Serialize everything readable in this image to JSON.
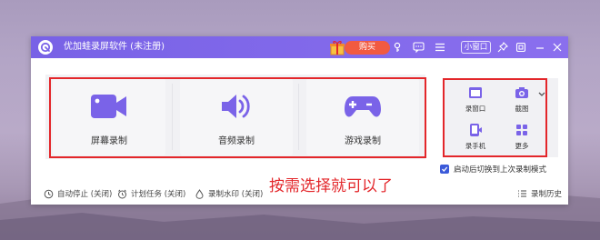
{
  "window": {
    "title": "优加蛙录屏软件 (未注册)",
    "buy_label": "购买",
    "mini_label": "小窗口"
  },
  "modes": [
    {
      "label": "屏幕录制",
      "icon": "video-camera-icon"
    },
    {
      "label": "音频录制",
      "icon": "speaker-icon"
    },
    {
      "label": "游戏录制",
      "icon": "gamepad-icon"
    }
  ],
  "side_tools": [
    {
      "label": "录窗口",
      "icon": "window-icon"
    },
    {
      "label": "截图",
      "icon": "camera-icon"
    },
    {
      "label": "录手机",
      "icon": "phone-icon"
    },
    {
      "label": "更多",
      "icon": "grid-icon"
    }
  ],
  "checkbox": {
    "label": "启动后切换到上次录制模式",
    "checked": true
  },
  "annotation": "按需选择就可以了",
  "footer": {
    "auto_stop": "自动停止 (关闭)",
    "schedule": "计划任务 (关闭)",
    "watermark": "录制水印 (关闭)",
    "history": "录制历史"
  },
  "colors": {
    "accent": "#7a63e8",
    "buy": "#f15a41",
    "highlight": "#e3262a",
    "checkbox": "#3b5ad9"
  }
}
